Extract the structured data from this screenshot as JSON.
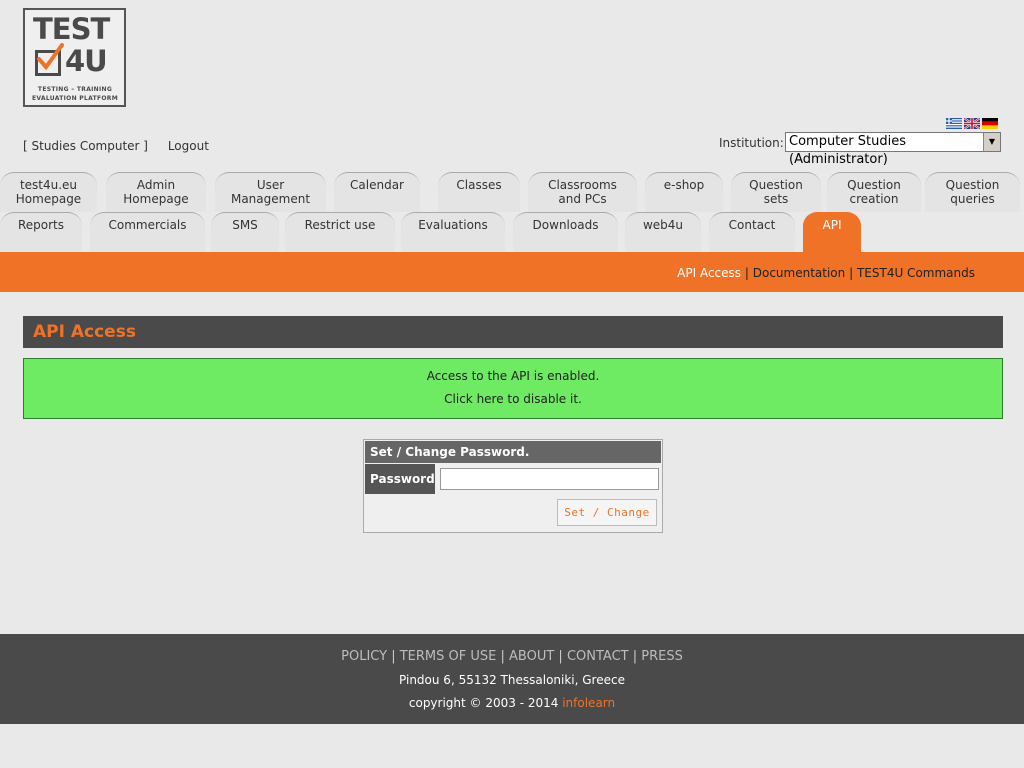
{
  "logo": {
    "line1": "TEST",
    "line2": "4U",
    "sub1": "TESTING  –  TRAINING",
    "sub2": "EVALUATION PLATFORM"
  },
  "flags": [
    {
      "name": "greek-flag-icon"
    },
    {
      "name": "uk-flag-icon"
    },
    {
      "name": "german-flag-icon"
    }
  ],
  "user": {
    "name": "[ Studies Computer ]",
    "logout": "Logout"
  },
  "institution": {
    "label": "Institution:",
    "value": "Computer Studies (Administrator)"
  },
  "tabs_row1": [
    {
      "label": "test4u.eu\nHomepage"
    },
    {
      "label": "Admin\nHomepage"
    },
    {
      "label": "User\nManagement"
    },
    {
      "label": "Calendar"
    },
    {
      "label": "Classes"
    },
    {
      "label": "Classrooms\nand PCs"
    },
    {
      "label": "e-shop"
    },
    {
      "label": "Question\nsets"
    },
    {
      "label": "Question\ncreation"
    },
    {
      "label": "Question\nqueries"
    }
  ],
  "tabs_row2": [
    {
      "label": "Reports"
    },
    {
      "label": "Commercials"
    },
    {
      "label": "SMS"
    },
    {
      "label": "Restrict use"
    },
    {
      "label": "Evaluations"
    },
    {
      "label": "Downloads"
    },
    {
      "label": "web4u"
    },
    {
      "label": "Contact"
    },
    {
      "label": "API"
    }
  ],
  "subnav": {
    "api_access": "API Access",
    "sep": "|",
    "documentation": "Documentation",
    "commands": "TEST4U Commands"
  },
  "section_title": "API Access",
  "notice": {
    "status": "Access to the API is enabled.",
    "action": "Click here to disable it."
  },
  "password_form": {
    "title": "Set / Change Password.",
    "label": "Password",
    "value": "",
    "button": "Set / Change"
  },
  "footer": {
    "links": [
      "POLICY",
      "TERMS OF USE",
      "ABOUT",
      "CONTACT",
      "PRESS"
    ],
    "separator": " | ",
    "address": "Pindou 6, 55132 Thessaloniki, Greece",
    "copyright": "copyright © 2003 - 2014 ",
    "brand": "infolearn"
  },
  "colors": {
    "accent": "#f07227",
    "dark": "#4a4a4a",
    "success": "#6eeb62",
    "background": "#e9e9e9"
  }
}
